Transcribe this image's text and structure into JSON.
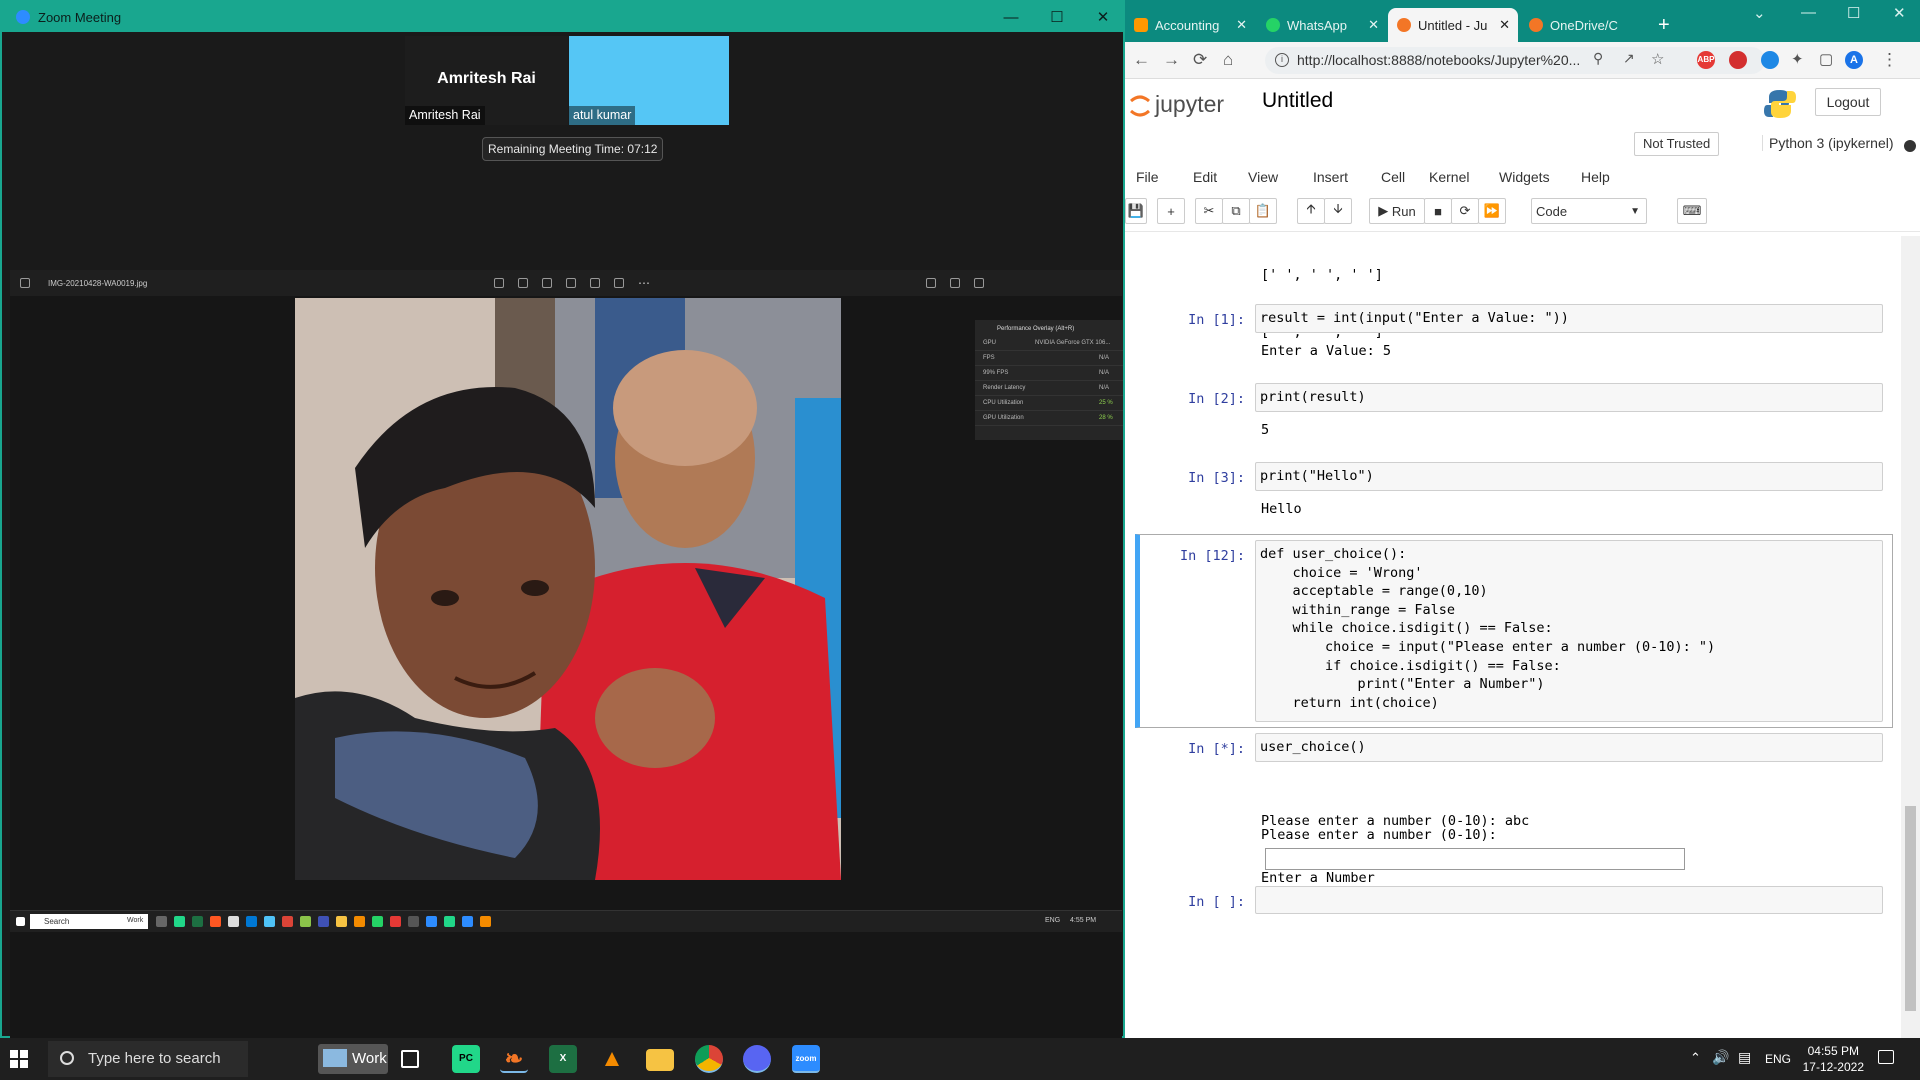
{
  "zoom": {
    "window_title": "Zoom Meeting",
    "participants": [
      {
        "display_name": "Amritesh Rai",
        "label": "Amritesh Rai",
        "tile_color": "#1d1d1d"
      },
      {
        "label": "atul kumar",
        "tile_color": "#55c6f5"
      }
    ],
    "remaining_time": "Remaining Meeting Time: 07:12",
    "shared_screen": {
      "file_name": "IMG-20210428-WA0019.jpg",
      "perf_overlay": {
        "title": "Performance Overlay (Alt+R)",
        "rows": [
          {
            "label": "GPU",
            "value": "NVIDIA GeForce GTX 106..."
          },
          {
            "label": "FPS",
            "value": "N/A"
          },
          {
            "label": "99% FPS",
            "value": "N/A"
          },
          {
            "label": "Render Latency",
            "value": "N/A"
          },
          {
            "label": "CPU Utilization",
            "value": "25 %"
          },
          {
            "label": "GPU Utilization",
            "value": "28 %"
          }
        ]
      },
      "mini_taskbar": {
        "search": "Search",
        "work": "Work",
        "lang": "ENG",
        "time": "4:55 PM"
      }
    }
  },
  "browser": {
    "tabs": [
      {
        "label": "Accounting",
        "icon_color": "#ff9800",
        "icon": "accounting-icon"
      },
      {
        "label": "WhatsApp",
        "icon_color": "#25d366",
        "icon": "whatsapp-icon"
      },
      {
        "label": "Untitled - Ju",
        "icon_color": "#f37626",
        "icon": "jupyter-icon",
        "active": true
      },
      {
        "label": "OneDrive/C",
        "icon_color": "#f37626",
        "icon": "jupyter-icon"
      }
    ],
    "url": "http://localhost:8888/notebooks/Jupyter%20...",
    "profile_initial": "A"
  },
  "jupyter": {
    "logo_text": "jupyter",
    "notebook_title": "Untitled",
    "logout_label": "Logout",
    "trust_label": "Not Trusted",
    "kernel_label": "Python 3 (ipykernel)",
    "menu": [
      "File",
      "Edit",
      "View",
      "Insert",
      "Cell",
      "Kernel",
      "Widgets",
      "Help"
    ],
    "run_label": "Run",
    "cell_type": "Code",
    "partial_output": [
      "[' ', ' ', ' ']",
      "[' ', ' ', ' ']"
    ],
    "cells": [
      {
        "prompt": "In [1]:",
        "code": "result = int(input(\"Enter a Value: \"))",
        "output": "Enter a Value: 5"
      },
      {
        "prompt": "In [2]:",
        "code": "print(result)",
        "output": "5"
      },
      {
        "prompt": "In [3]:",
        "code": "print(\"Hello\")",
        "output": "Hello"
      },
      {
        "prompt": "In [12]:",
        "code_lines": [
          "def user_choice():",
          "    choice = 'Wrong'",
          "    acceptable = range(0,10)",
          "    within_range = False",
          "    while choice.isdigit() == False:",
          "        choice = input(\"Please enter a number (0-10): \")",
          "        if choice.isdigit() == False:",
          "            print(\"Enter a Number\")",
          "    return int(choice)"
        ]
      },
      {
        "prompt": "In [*]:",
        "code": "user_choice()",
        "output_lines": [
          "Please enter a number (0-10): abc",
          "Enter a Number"
        ],
        "input_prompt": "Please enter a number (0-10):"
      },
      {
        "prompt": "In [ ]:",
        "code": ""
      }
    ]
  },
  "taskbar": {
    "search_placeholder": "Type here to search",
    "work_label": "Work",
    "lang": "ENG",
    "time": "04:55 PM",
    "date": "17-12-2022",
    "apps": [
      {
        "name": "task-view-icon",
        "color": "#1f1f1f"
      },
      {
        "name": "pycharm-icon",
        "color": "#21d789",
        "text": "PC"
      },
      {
        "name": "jupyter-app-icon",
        "color": "#1f1f1f"
      },
      {
        "name": "excel-icon",
        "color": "#1d6f42",
        "text": "X"
      },
      {
        "name": "vlc-icon",
        "color": "#f48b00"
      },
      {
        "name": "file-explorer-icon",
        "color": "#f6c343"
      },
      {
        "name": "chrome-icon",
        "color": "#db4437"
      },
      {
        "name": "discord-icon",
        "color": "#5865f2"
      },
      {
        "name": "zoom-icon",
        "color": "#2d8cff",
        "text": "zoom"
      }
    ]
  }
}
